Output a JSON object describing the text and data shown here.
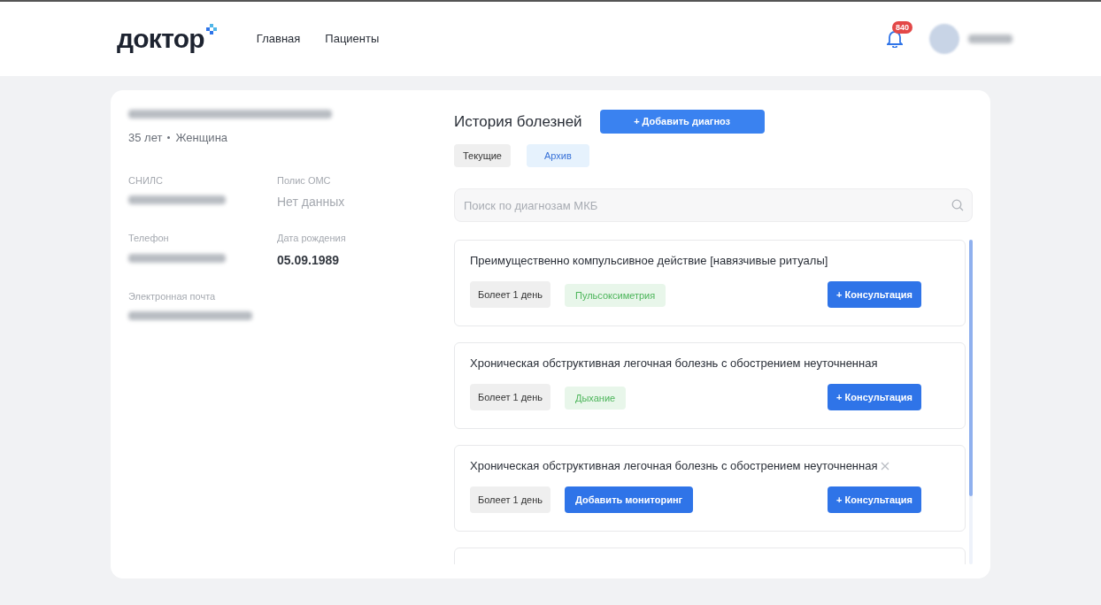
{
  "header": {
    "logo": "доктор",
    "nav": [
      {
        "label": "Главная",
        "selected": false
      },
      {
        "label": "Пациенты",
        "selected": false
      }
    ],
    "notifications": {
      "count": "840"
    }
  },
  "patient": {
    "summary": [
      "35 лет",
      "Женщина"
    ],
    "fields": [
      {
        "label": "СНИЛС"
      },
      {
        "label": "Полис ОМС",
        "value": "Нет данных",
        "empty": true
      },
      {
        "label": "Телефон"
      },
      {
        "label": "Дата рождения",
        "value": "05.09.1989",
        "empty": false
      },
      {
        "label": "Электронная почта"
      }
    ]
  },
  "history": {
    "title": "История болезней",
    "add_button": "+ Добавить диагноз",
    "tabs": [
      {
        "label": "Текущие",
        "selected": false
      },
      {
        "label": "Архив",
        "selected": true
      }
    ],
    "search": {
      "placeholder": "Поиск по диагнозам МКБ"
    },
    "diagnoses": [
      {
        "title": "Преимущественно компульсивное действие [навязчивые ритуалы]",
        "duration": "Болеет 1 день",
        "monitoring": {
          "kind": "tag",
          "label": "Пульсоксиметрия"
        },
        "consult": "+ Консультация",
        "closable": false
      },
      {
        "title": "Хроническая обструктивная легочная болезнь с обострением неуточненная",
        "duration": "Болеет 1 день",
        "monitoring": {
          "kind": "tag",
          "label": "Дыхание"
        },
        "consult": "+ Консультация",
        "closable": false
      },
      {
        "title": "Хроническая обструктивная легочная болезнь с обострением неуточненная",
        "duration": "Болеет 1 день",
        "monitoring": {
          "kind": "button",
          "label": "Добавить мониторинг"
        },
        "consult": "+ Консультация",
        "closable": true
      }
    ]
  }
}
